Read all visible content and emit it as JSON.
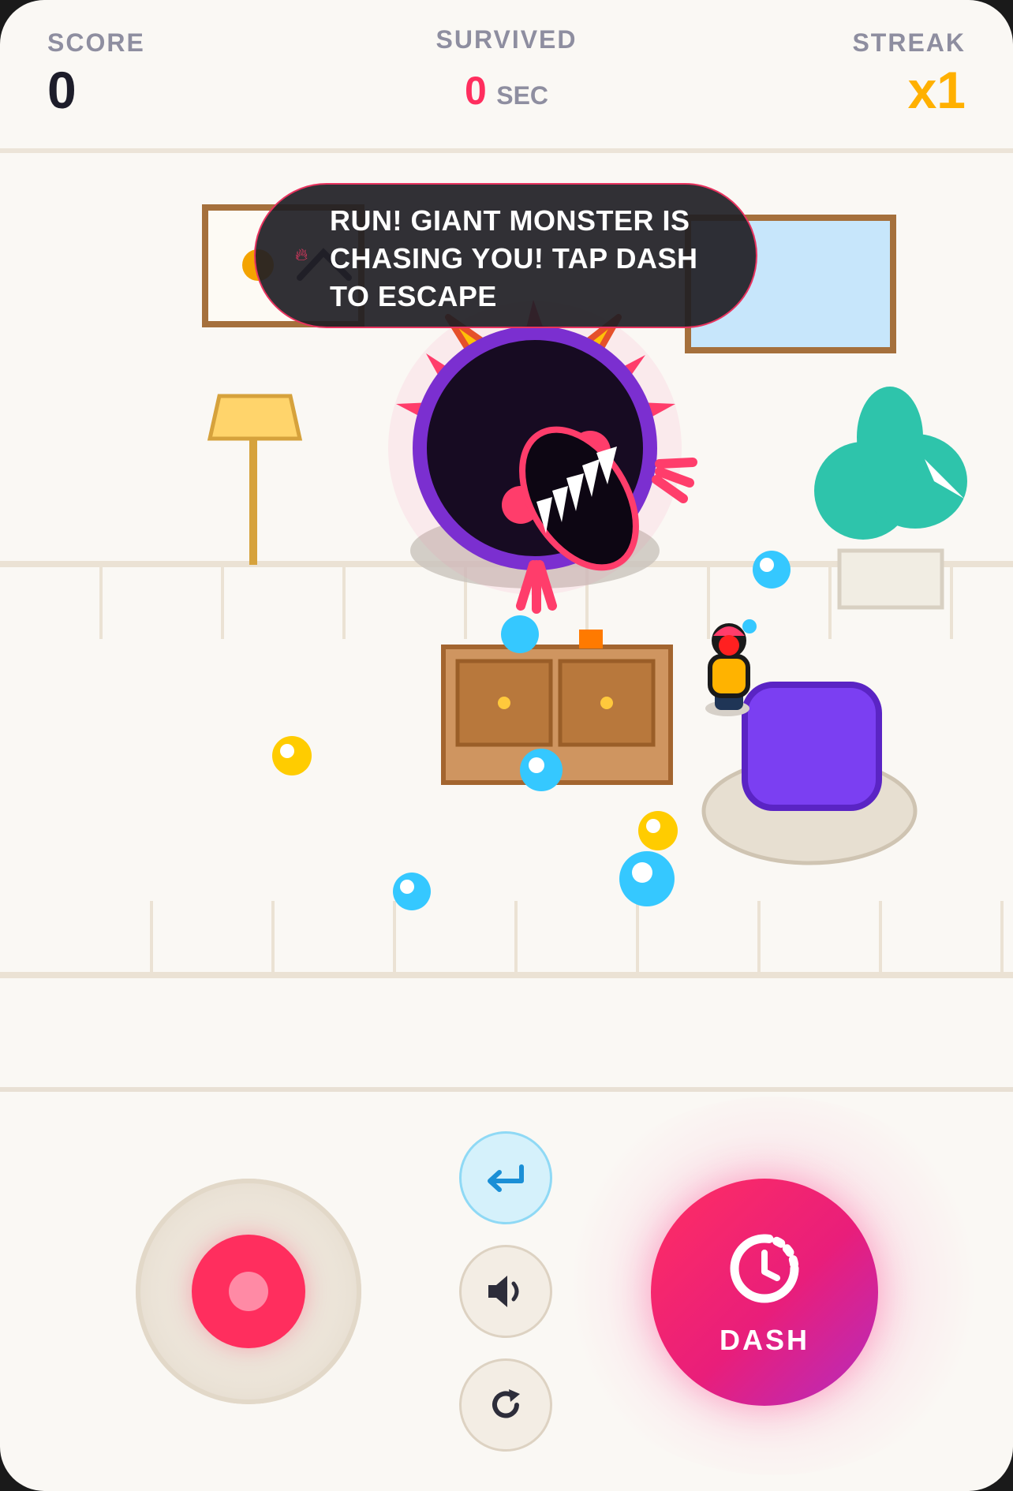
{
  "hud": {
    "score_label": "SCORE",
    "score_value": "0",
    "survived_label": "SURVIVED",
    "survived_value": "0",
    "survived_unit": "SEC",
    "streak_label": "STREAK",
    "streak_value": "x1"
  },
  "message": {
    "icon": "flame-icon",
    "text": "RUN! GIANT MONSTER IS CHASING YOU! TAP DASH TO ESCAPE"
  },
  "controls": {
    "dash_label": "DASH",
    "dash_icon": "stopwatch-icon",
    "back_icon": "return-arrow-icon",
    "sound_icon": "speaker-icon",
    "restart_icon": "restart-icon",
    "joystick": "joystick"
  },
  "colors": {
    "accent": "#ff2e5e",
    "streak": "#ffb000",
    "monster_ring": "#7b2fd0",
    "monster_body": "#170b22",
    "orb_blue": "#35c8ff",
    "orb_gold": "#ffcc00",
    "player_body": "#ffb300",
    "armchair": "#7b3ff2"
  }
}
